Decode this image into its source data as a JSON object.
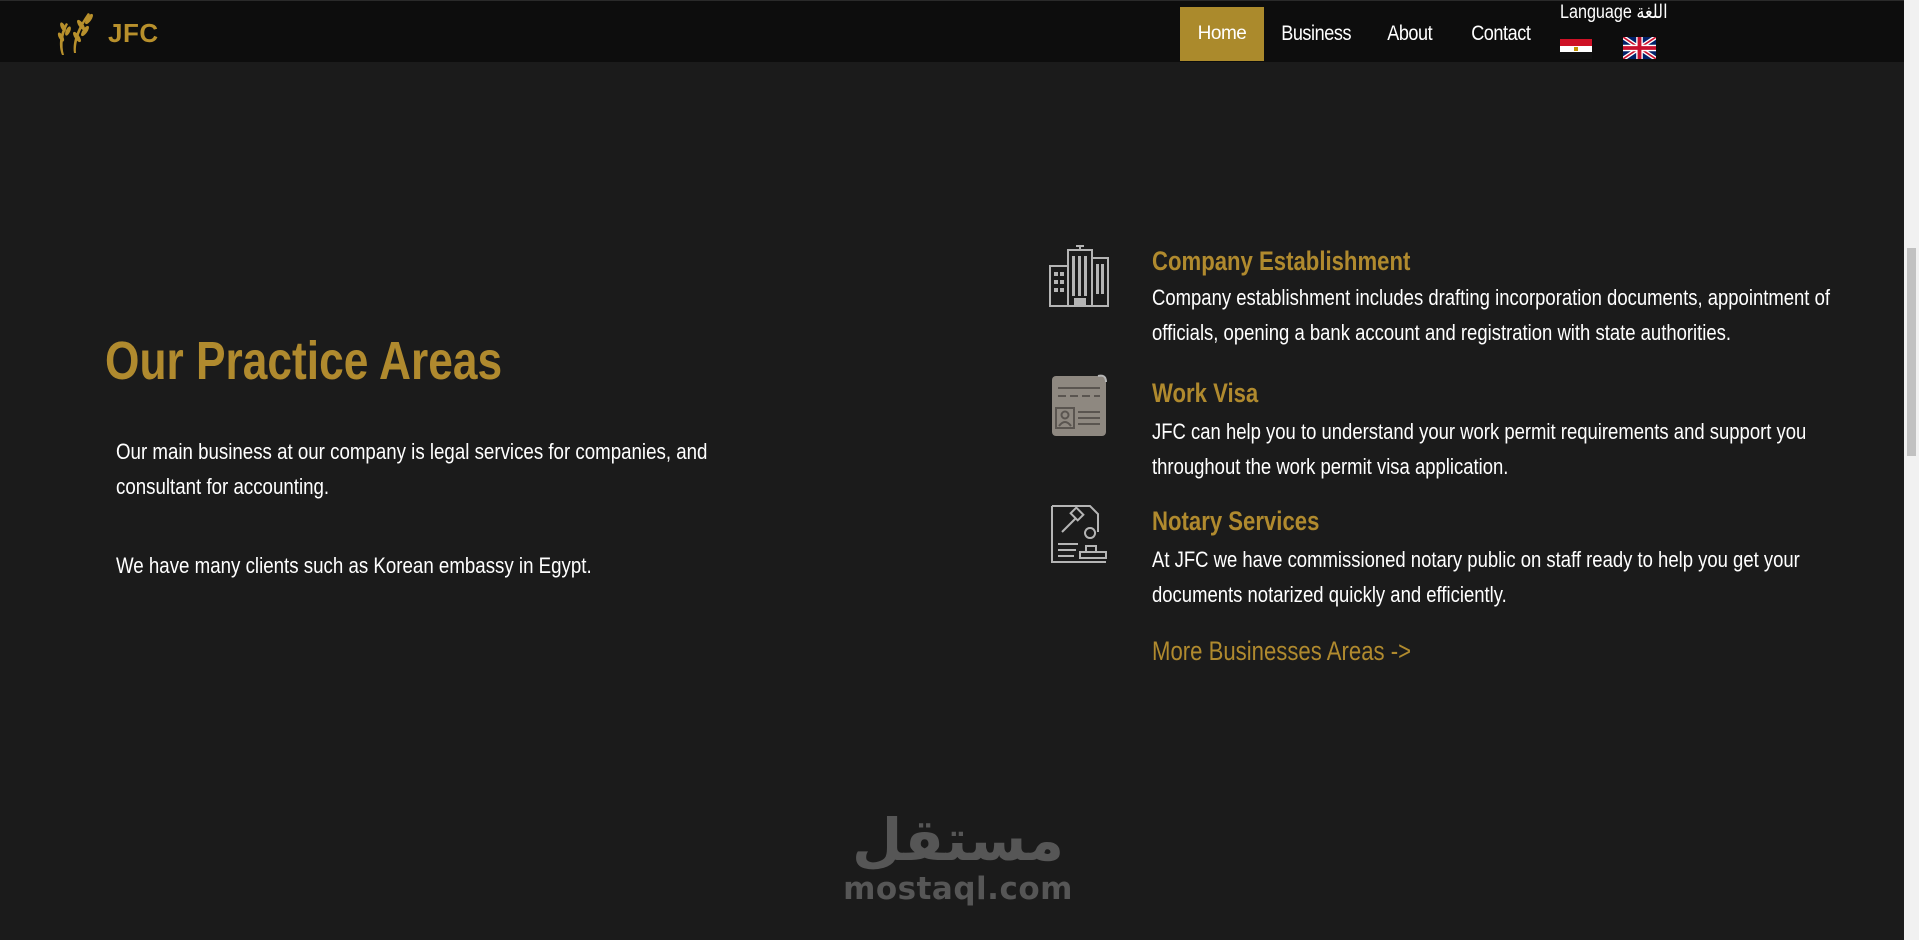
{
  "header": {
    "logo_text": "JFC",
    "nav": [
      {
        "label": "Home",
        "active": true
      },
      {
        "label": "Business",
        "active": false
      },
      {
        "label": "About",
        "active": false
      },
      {
        "label": "Contact",
        "active": false
      }
    ],
    "language_label": "Language اللغة",
    "flags": [
      "egypt-flag-icon",
      "uk-flag-icon"
    ]
  },
  "practice": {
    "heading": "Our Practice Areas",
    "intro": "Our main business at our company is legal services for companies, and consultant for accounting.",
    "clients": "We have many clients such as Korean embassy in Egypt."
  },
  "services": [
    {
      "icon": "building-icon",
      "title": "Company Establishment",
      "description": "Company establishment includes drafting incorporation documents, appointment of officials, opening a bank account and registration with state authorities."
    },
    {
      "icon": "id-document-icon",
      "title": "Work Visa",
      "description": "JFC can help you to understand your work permit requirements and support you throughout the work permit visa application."
    },
    {
      "icon": "notary-stamp-icon",
      "title": "Notary Services",
      "description": "At JFC we have commissioned notary public on staff ready to help you get your documents notarized quickly and efficiently."
    }
  ],
  "more_link": "More Businesses Areas ->",
  "watermark": {
    "arabic": "مستقل",
    "latin": "mostaql.com"
  },
  "colors": {
    "accent": "#b08a2e",
    "background": "#1b1b1b",
    "header": "#0d0d0d",
    "active_nav": "#ab8a2c"
  }
}
